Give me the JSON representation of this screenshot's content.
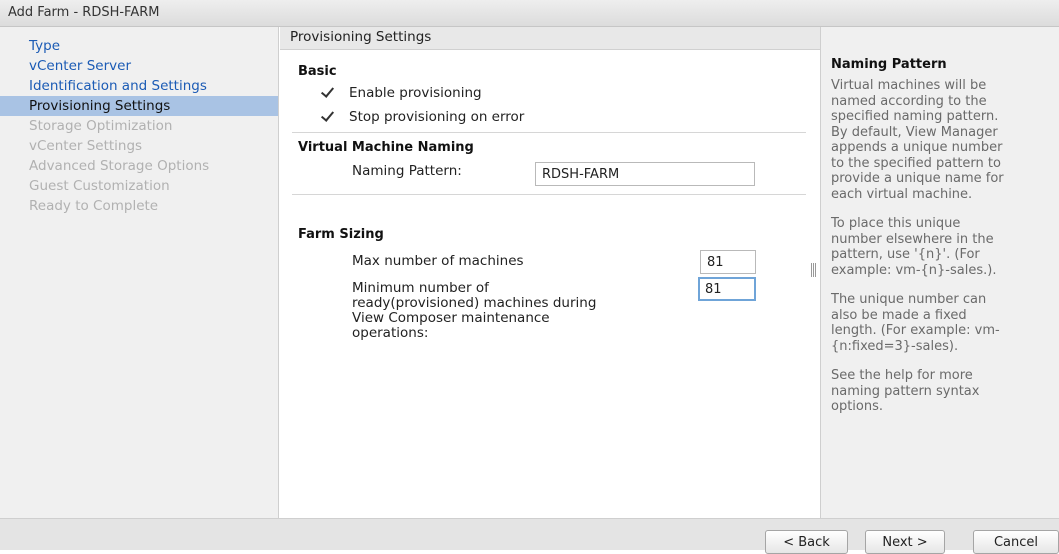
{
  "window": {
    "title": "Add Farm - RDSH-FARM"
  },
  "nav": {
    "items": [
      {
        "label": "Type",
        "state": "link"
      },
      {
        "label": "vCenter Server",
        "state": "link"
      },
      {
        "label": "Identification and Settings",
        "state": "link"
      },
      {
        "label": "Provisioning Settings",
        "state": "active"
      },
      {
        "label": "Storage Optimization",
        "state": "disabled"
      },
      {
        "label": "vCenter Settings",
        "state": "disabled"
      },
      {
        "label": "Advanced Storage Options",
        "state": "disabled"
      },
      {
        "label": "Guest Customization",
        "state": "disabled"
      },
      {
        "label": "Ready to Complete",
        "state": "disabled"
      }
    ]
  },
  "main": {
    "header": "Provisioning Settings",
    "basic": {
      "title": "Basic",
      "enable_provisioning": {
        "label": "Enable provisioning",
        "checked": true
      },
      "stop_on_error": {
        "label": "Stop provisioning on error",
        "checked": true
      }
    },
    "naming": {
      "title": "Virtual Machine Naming",
      "pattern_label": "Naming Pattern:",
      "pattern_value": "RDSH-FARM"
    },
    "sizing": {
      "title": "Farm Sizing",
      "max_label": "Max number of machines",
      "max_value": "81",
      "min_label": "Minimum number of\nready(provisioned) machines during\nView Composer maintenance\noperations:",
      "min_value": "81"
    }
  },
  "help": {
    "title": "Naming Pattern",
    "paragraphs": [
      "Virtual machines will be\nnamed according to the\nspecified naming pattern.\nBy default, View Manager\nappends a unique number\nto the specified pattern to\nprovide a unique name for\neach virtual machine.",
      "To place this unique\nnumber elsewhere in the\npattern, use '{n}'. (For\nexample: vm-{n}-sales.).",
      "The unique number can\nalso be made a fixed\nlength. (For example: vm-\n{n:fixed=3}-sales).",
      "See the help for more\nnaming pattern syntax\noptions."
    ]
  },
  "footer": {
    "back_label": "< Back",
    "next_label": "Next >",
    "cancel_label": "Cancel"
  },
  "colors": {
    "link": "#1b5bb5",
    "active_nav": "#a9c3e4",
    "disabled_nav": "#b1b1b1",
    "focus_border": "#6fa4d8"
  }
}
